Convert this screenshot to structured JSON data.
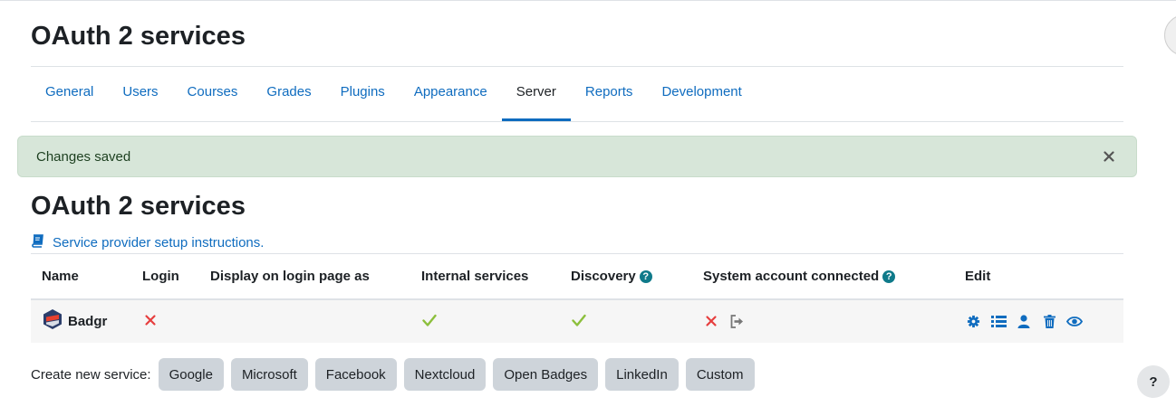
{
  "page": {
    "title": "OAuth 2 services"
  },
  "tabs": [
    {
      "label": "General"
    },
    {
      "label": "Users"
    },
    {
      "label": "Courses"
    },
    {
      "label": "Grades"
    },
    {
      "label": "Plugins"
    },
    {
      "label": "Appearance"
    },
    {
      "label": "Server",
      "active": true
    },
    {
      "label": "Reports"
    },
    {
      "label": "Development"
    }
  ],
  "alert": {
    "message": "Changes saved",
    "close_icon": "close-icon",
    "color": "#d7e6d9"
  },
  "section": {
    "title": "OAuth 2 services",
    "instructions_link": "Service provider setup instructions.",
    "instructions_icon": "book-icon"
  },
  "table": {
    "headers": {
      "name": "Name",
      "login": "Login",
      "display": "Display on login page as",
      "internal": "Internal services",
      "discovery": "Discovery",
      "system": "System account connected",
      "edit": "Edit"
    },
    "rows": [
      {
        "name": "Badgr",
        "login": "disabled",
        "display": "",
        "internal": "enabled",
        "discovery": "enabled",
        "system": "not-connected",
        "edit_icons": [
          "gear-icon",
          "list-icon",
          "user-icon",
          "trash-icon",
          "eye-icon"
        ]
      }
    ]
  },
  "create": {
    "label": "Create new service:",
    "buttons": [
      "Google",
      "Microsoft",
      "Facebook",
      "Nextcloud",
      "Open Badges",
      "LinkedIn",
      "Custom"
    ]
  },
  "help": {
    "label": "?"
  },
  "colors": {
    "accent": "#0f6cbf",
    "check": "#8cbf3c",
    "cross": "#e63e3e",
    "help": "#0f7a8a",
    "button": "#ced4da"
  }
}
